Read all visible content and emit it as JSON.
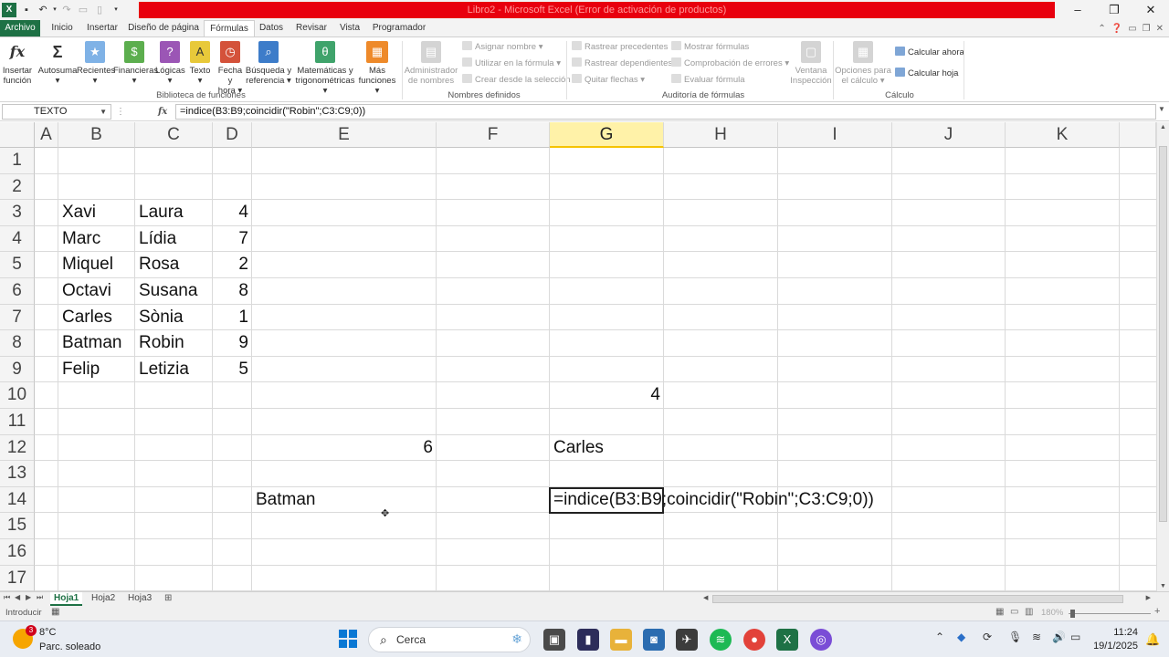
{
  "window": {
    "title": "Libro2 - Microsoft Excel (Error de activación de productos)",
    "controls": [
      "minimize",
      "restore",
      "close"
    ]
  },
  "ribbon_tabs": [
    "Archivo",
    "Inicio",
    "Insertar",
    "Diseño de página",
    "Fórmulas",
    "Datos",
    "Revisar",
    "Vista",
    "Programador"
  ],
  "active_tab": "Fórmulas",
  "ribbon": {
    "groups": {
      "biblioteca": "Biblioteca de funciones",
      "nombres": "Nombres definidos",
      "auditoria": "Auditoría de fórmulas",
      "calculo": "Cálculo"
    },
    "buttons": {
      "insertar_funcion_1": "Insertar",
      "insertar_funcion_2": "función",
      "autosuma": "Autosuma",
      "recientes": "Recientes",
      "financieras": "Financieras",
      "logicas": "Lógicas",
      "texto": "Texto",
      "fecha_1": "Fecha y",
      "fecha_2": "hora",
      "busqueda_1": "Búsqueda y",
      "busqueda_2": "referencia",
      "matematicas_1": "Matemáticas y",
      "matematicas_2": "trigonométricas",
      "mas_1": "Más",
      "mas_2": "funciones",
      "administrador_1": "Administrador",
      "administrador_2": "de nombres",
      "asignar_nombre": "Asignar nombre",
      "utilizar_formula": "Utilizar en la fórmula",
      "crear_seleccion": "Crear desde la selección",
      "rastrear_precedentes": "Rastrear precedentes",
      "rastrear_dependientes": "Rastrear dependientes",
      "quitar_flechas": "Quitar flechas",
      "mostrar_formulas": "Mostrar fórmulas",
      "comprobacion_errores": "Comprobación de errores",
      "evaluar_formula": "Evaluar fórmula",
      "ventana_1": "Ventana",
      "ventana_2": "Inspección",
      "opciones_1": "Opciones para",
      "opciones_2": "el cálculo",
      "calcular_ahora": "Calcular ahora",
      "calcular_hoja": "Calcular hoja"
    }
  },
  "formula_bar": {
    "name_box": "TEXTO",
    "formula": "=indice(B3:B9;coincidir(\"Robin\";C3:C9;0))"
  },
  "grid": {
    "columns": [
      "A",
      "B",
      "C",
      "D",
      "E",
      "F",
      "G",
      "H",
      "I",
      "J",
      "K"
    ],
    "selected_column": "G",
    "rows": [
      "1",
      "2",
      "3",
      "4",
      "5",
      "6",
      "7",
      "8",
      "9",
      "10",
      "11",
      "12",
      "13",
      "14",
      "15",
      "16",
      "17"
    ],
    "cells": {
      "B3": "Xavi",
      "C3": "Laura",
      "D3": "4",
      "B4": "Marc",
      "C4": "Lídia",
      "D4": "7",
      "B5": "Miquel",
      "C5": "Rosa",
      "D5": "2",
      "B6": "Octavi",
      "C6": "Susana",
      "D6": "8",
      "B7": "Carles",
      "C7": "Sònia",
      "D7": "1",
      "B8": "Batman",
      "C8": "Robin",
      "D8": "9",
      "B9": "Felip",
      "C9": "Letizia",
      "D9": "5",
      "G10": "4",
      "E12": "6",
      "G12": "Carles",
      "E14": "Batman"
    },
    "editing_cell": "G14",
    "editing_text": "=indice(B3:B9;coincidir(\"Robin\";C3:C9;0))"
  },
  "sheets": [
    "Hoja1",
    "Hoja2",
    "Hoja3"
  ],
  "active_sheet": "Hoja1",
  "status": {
    "mode": "Introducir",
    "zoom": "180%"
  },
  "taskbar": {
    "weather_temp": "8°C",
    "weather_desc": "Parc. soleado",
    "weather_badge": "3",
    "search_placeholder": "Cerca",
    "time": "11:24",
    "date": "19/1/2025"
  }
}
